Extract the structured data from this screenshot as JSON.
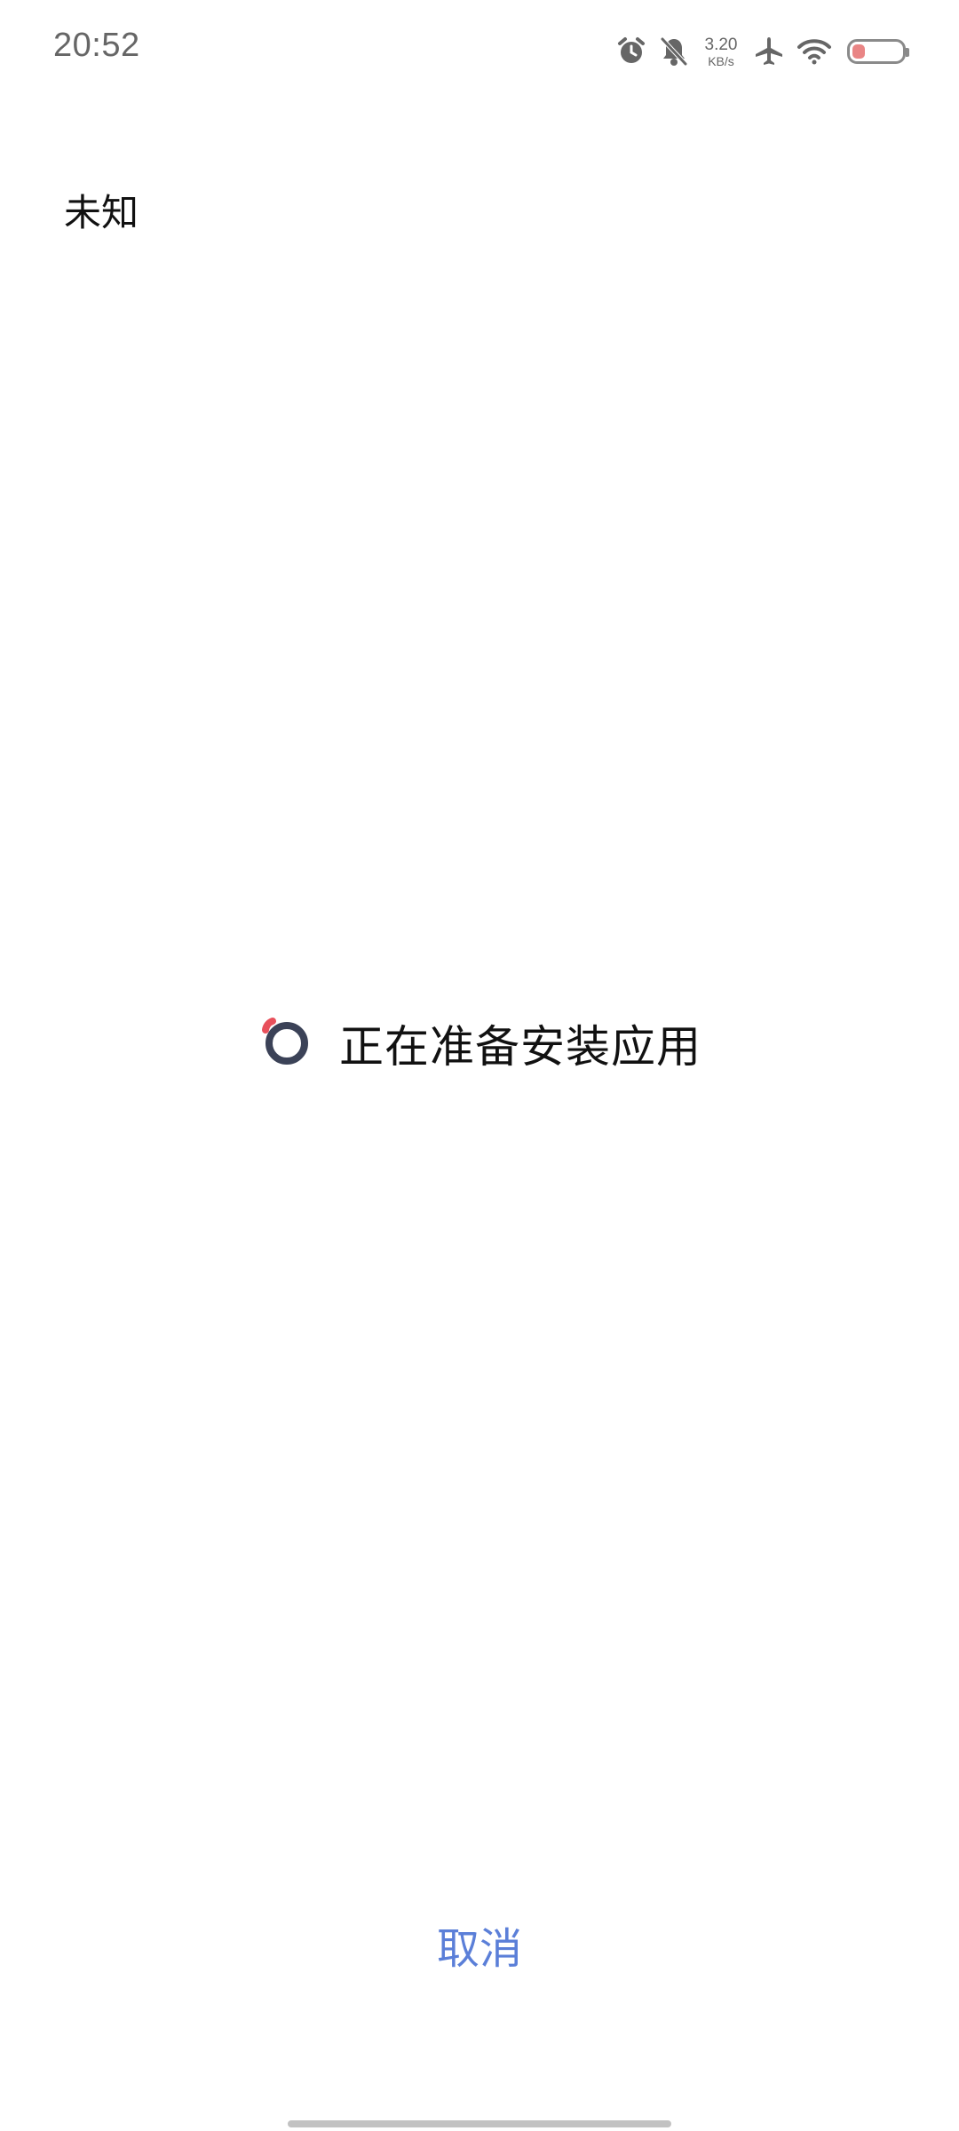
{
  "status_bar": {
    "time": "20:52",
    "net_speed_value": "3.20",
    "net_speed_unit": "KB/s",
    "battery_level": 0.25,
    "icons": [
      "alarm-icon",
      "bell-off-icon",
      "airplane-icon",
      "wifi-icon",
      "battery-icon"
    ]
  },
  "app": {
    "title": "未知"
  },
  "progress": {
    "text": "正在准备安装应用"
  },
  "actions": {
    "cancel_label": "取消"
  },
  "colors": {
    "accent": "#5b7fd8",
    "spinner_ring": "#3b4257",
    "spinner_accent": "#e8505b"
  }
}
